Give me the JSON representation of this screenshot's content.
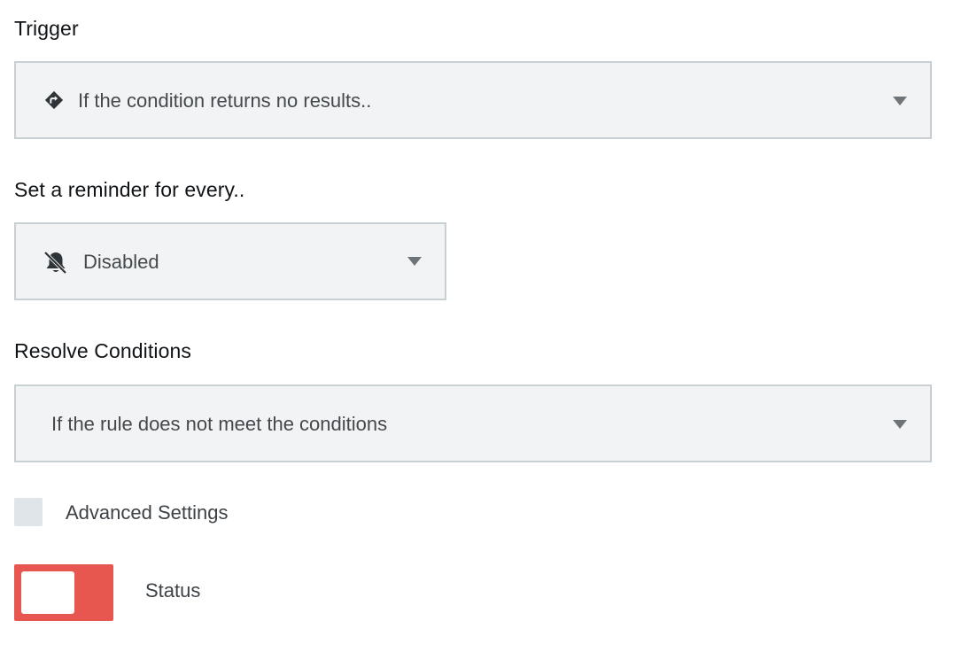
{
  "trigger": {
    "label": "Trigger",
    "value": "If the condition returns no results..",
    "icon": "directions-icon"
  },
  "reminder": {
    "label": "Set a reminder for every..",
    "value": "Disabled",
    "icon": "bell-off-icon"
  },
  "resolve": {
    "label": "Resolve Conditions",
    "value": "If the rule does not meet the conditions"
  },
  "advanced": {
    "label": "Advanced Settings",
    "checked": false
  },
  "status": {
    "label": "Status",
    "on": false,
    "color": "#e8574f"
  }
}
